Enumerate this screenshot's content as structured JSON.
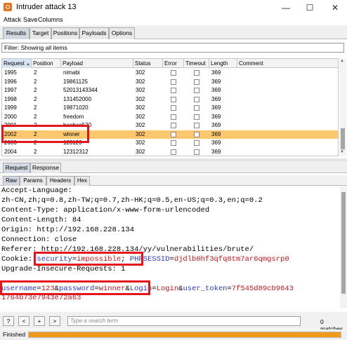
{
  "window": {
    "title": "Intruder attack 13",
    "minimize": "—",
    "maximize": "☐",
    "close": "✕"
  },
  "menu": [
    "Attack",
    "Save",
    "Columns"
  ],
  "tabs": [
    "Results",
    "Target",
    "Positions",
    "Payloads",
    "Options"
  ],
  "filter": "Filter: Showing all items",
  "table": {
    "headers": [
      "Request",
      "Position",
      "Payload",
      "Status",
      "Error",
      "Timeout",
      "Length",
      "Comment"
    ],
    "sort_indicator": "▲",
    "rows": [
      {
        "request": "1995",
        "position": "2",
        "payload": "nimabi",
        "status": "302",
        "length": "369"
      },
      {
        "request": "1996",
        "position": "2",
        "payload": "19861125",
        "status": "302",
        "length": "369"
      },
      {
        "request": "1997",
        "position": "2",
        "payload": "52013143344",
        "status": "302",
        "length": "369"
      },
      {
        "request": "1998",
        "position": "2",
        "payload": "131452000",
        "status": "302",
        "length": "369"
      },
      {
        "request": "1999",
        "position": "2",
        "payload": "19871020",
        "status": "302",
        "length": "369"
      },
      {
        "request": "2000",
        "position": "2",
        "payload": "freedom",
        "status": "302",
        "length": "369"
      },
      {
        "request": "2001",
        "position": "2",
        "payload": "baobao520",
        "status": "302",
        "length": "369"
      },
      {
        "request": "2002",
        "position": "2",
        "payload": "winner",
        "status": "302",
        "length": "369"
      },
      {
        "request": "2003",
        "position": "2",
        "payload": "123123",
        "status": "302",
        "length": "369"
      },
      {
        "request": "2004",
        "position": "2",
        "payload": "12312312",
        "status": "302",
        "length": "369"
      }
    ]
  },
  "detail_tabs": [
    "Request",
    "Response"
  ],
  "view_tabs": [
    "Raw",
    "Params",
    "Headers",
    "Hex"
  ],
  "request_text": {
    "l1": "Accept-Language:",
    "l2": "zh-CN,zh;q=0.8,zh-TW;q=0.7,zh-HK;q=0.5,en-US;q=0.3,en;q=0.2",
    "l3": "Content-Type: application/x-www-form-urlencoded",
    "l4": "Content-Length: 84",
    "l5": "Origin: http://192.168.228.134",
    "l6": "Connection: close",
    "l7": "Referer: http://192.168.228.134/yy/vulnerabilities/brute/",
    "cookie_prefix": "Cookie: ",
    "cookie_name1": "security",
    "cookie_val1": "impossible",
    "cookie_sep": "; ",
    "cookie_name2": "PHPSESSID",
    "cookie_val2": "djdlb0hf3qfq8tm7ar6qmgsrp0",
    "l9": "Upgrade-Insecure-Requests: 1",
    "b_name1": "username",
    "b_val1": "123",
    "b_name2": "password",
    "b_val2": "winner",
    "b_name3": "Login",
    "b_val3": "Login",
    "b_name4": "user_token",
    "b_val4": "7f545d89cb9643",
    "b_cont": "1764b73e7943e72a63",
    "eq": "=",
    "amp": "&",
    "semi": ";"
  },
  "search": {
    "help": "?",
    "prev": "<",
    "add": "+",
    "next": ">",
    "placeholder": "Type a search term",
    "matches": "0 matches"
  },
  "status": {
    "text": "Finished",
    "progress": 1.0
  },
  "colors": {
    "accent": "#f09a1c",
    "selected_row": "#ffc86e",
    "param_name": "#2a38c9",
    "param_value": "#c8141a",
    "highlight_box": "#e4161b"
  }
}
